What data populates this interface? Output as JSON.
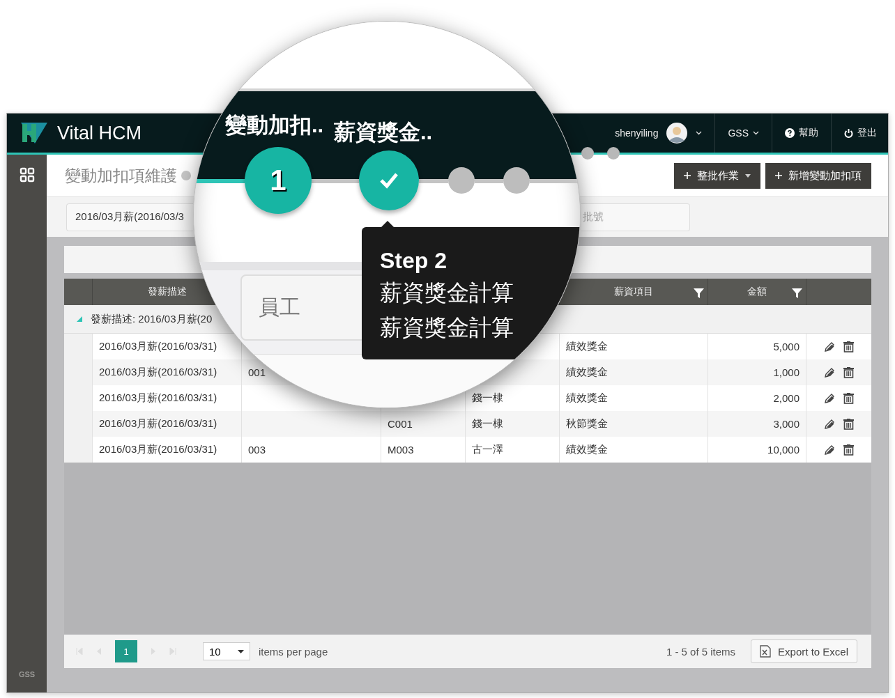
{
  "app": {
    "name": "Vital HCM"
  },
  "header": {
    "user": "shenyiling",
    "company": "GSS",
    "help": "幫助",
    "logout": "登出"
  },
  "sidebar": {
    "footer": "GSS"
  },
  "page": {
    "title": "變動加扣項維護",
    "buttons": [
      {
        "label": "整批作業",
        "kind": "dropdown"
      },
      {
        "label": "新增變動加扣項",
        "kind": "plain"
      }
    ]
  },
  "filters": {
    "period": "2016/03月薪(2016/03/3",
    "batch_placeholder": "批號"
  },
  "table": {
    "columns": [
      {
        "label": "發薪描述",
        "filter": false
      },
      {
        "label": "薪資項目",
        "filter": true
      },
      {
        "label": "金額",
        "filter": true
      }
    ],
    "group": {
      "label": "發薪描述: 2016/03月薪(20",
      "expanded": true
    },
    "rows": [
      {
        "period": "2016/03月薪(2016/03/31)",
        "item": "績效獎金",
        "amount": "5,000"
      },
      {
        "period": "2016/03月薪(2016/03/31)",
        "code": "001",
        "item": "績效獎金",
        "amount": "1,000"
      },
      {
        "period": "2016/03月薪(2016/03/31)",
        "name": "錢一棣",
        "item": "績效獎金",
        "amount": "2,000"
      },
      {
        "period": "2016/03月薪(2016/03/31)",
        "dept": "C001",
        "name": "錢一棣",
        "item": "秋節獎金",
        "amount": "3,000"
      },
      {
        "period": "2016/03月薪(2016/03/31)",
        "code": "003",
        "dept": "M003",
        "name": "古一澤",
        "item": "績效獎金",
        "amount": "10,000"
      }
    ]
  },
  "pager": {
    "page": "1",
    "page_size": "10",
    "size_label": "items per page",
    "summary": "1 - 5 of 5 items",
    "export": "Export to Excel"
  },
  "magnifier": {
    "steps": [
      {
        "label": "變動加扣..",
        "number": "1",
        "kind": "number"
      },
      {
        "label": "薪資獎金..",
        "kind": "check"
      },
      {
        "kind": "dot"
      },
      {
        "kind": "dot"
      }
    ],
    "tooltip": {
      "title": "Step 2",
      "lines": [
        "薪資獎金計算",
        "薪資獎金計算"
      ]
    },
    "employee_field": {
      "placeholder": "員工"
    }
  }
}
